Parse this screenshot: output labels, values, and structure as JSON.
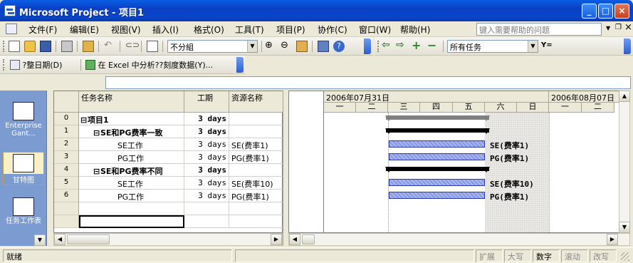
{
  "window": {
    "title": "Microsoft Project - 项目1",
    "controls": {
      "minimize": "_",
      "maximize": "□",
      "close": "×"
    }
  },
  "menu": {
    "items": [
      "文件(F)",
      "编辑(E)",
      "视图(V)",
      "插入(I)",
      "格式(O)",
      "工具(T)",
      "项目(P)",
      "协作(C)",
      "窗口(W)",
      "帮助(H)"
    ],
    "help_placeholder": "键入需要帮助的问题"
  },
  "toolbar_standard": {
    "group_value": "不分組",
    "filter_value": "所有任务",
    "filter_icon_text": "Y="
  },
  "toolbar_analysis": {
    "btn_adjust_dates": "?整日期(D)",
    "btn_analyze_excel": "在 Excel 中分析??刻度数据(Y)..."
  },
  "viewbar": {
    "items": [
      {
        "label": "Enterprise Gant..."
      },
      {
        "label": "甘特图"
      },
      {
        "label": "任务工作表"
      }
    ]
  },
  "grid": {
    "columns": [
      "任务名称",
      "工期",
      "资源名称"
    ],
    "rows": [
      {
        "id": "0",
        "name": "项目1",
        "duration": "3 days",
        "resource": "",
        "level": 0,
        "summary": true
      },
      {
        "id": "1",
        "name": "SE和PG费率一致",
        "duration": "3 days",
        "resource": "",
        "level": 1,
        "summary": true
      },
      {
        "id": "2",
        "name": "SE工作",
        "duration": "3 days",
        "resource": "SE(费率1)",
        "level": 2,
        "summary": false
      },
      {
        "id": "3",
        "name": "PG工作",
        "duration": "3 days",
        "resource": "PG(费率1)",
        "level": 2,
        "summary": false
      },
      {
        "id": "4",
        "name": "SE和PG费率不同",
        "duration": "3 days",
        "resource": "",
        "level": 1,
        "summary": true
      },
      {
        "id": "5",
        "name": "SE工作",
        "duration": "3 days",
        "resource": "SE(费率10)",
        "level": 2,
        "summary": false
      },
      {
        "id": "6",
        "name": "PG工作",
        "duration": "3 days",
        "resource": "PG(费率1)",
        "level": 2,
        "summary": false
      }
    ]
  },
  "gantt": {
    "week1_label": "2006年07月31日",
    "week2_label": "2006年08月07日",
    "days": [
      "一",
      "二",
      "三",
      "四",
      "五",
      "六",
      "日",
      "一",
      "二"
    ],
    "bar_labels": [
      "SE(费率1)",
      "PG(费率1)",
      "SE(费率10)",
      "PG(费率1)"
    ]
  },
  "status": {
    "ready": "就绪",
    "indicators": [
      "扩展",
      "大写",
      "数字",
      "滚动",
      "改写"
    ]
  }
}
